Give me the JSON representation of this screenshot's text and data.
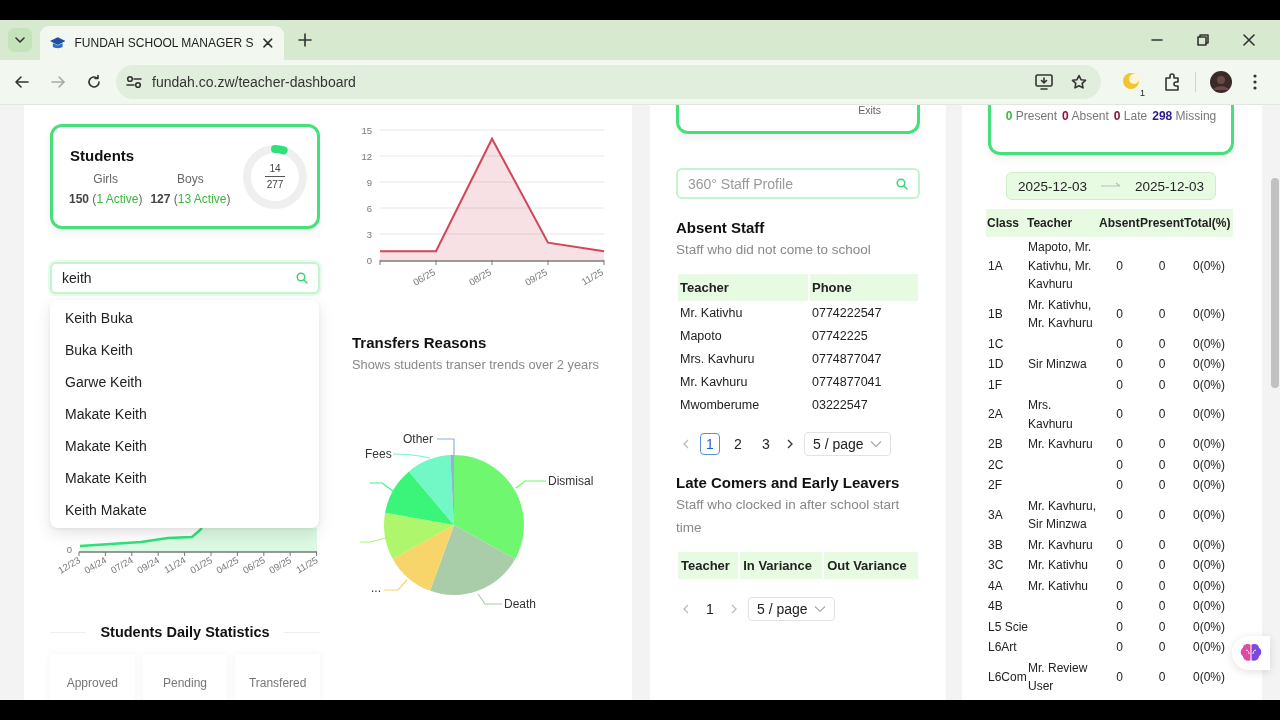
{
  "browser": {
    "tab_title": "FUNDAH SCHOOL MANAGER S",
    "url": "fundah.co.zw/teacher-dashboard",
    "extension_badge": "1"
  },
  "students_card": {
    "title": "Students",
    "groups": [
      {
        "label": "Girls",
        "value": "**150** (*1 Active*)"
      },
      {
        "label": "Boys",
        "value": "**127** (*13 Active*)"
      }
    ],
    "ring": {
      "active": "14",
      "total": "277",
      "level": 0.05
    }
  },
  "student_search": {
    "value": "keith",
    "suggestions": [
      "Keith Buka",
      "Buka Keith",
      "Garwe Keith",
      "Makate Keith",
      "Makate Keith",
      "Makate Keith",
      "Keith Makate"
    ]
  },
  "growth_chart": {
    "kind": "picture",
    "y_tick": "0",
    "x_labels": [
      "12/23",
      "04/24",
      "07/24",
      "09/24",
      "11/24",
      "01/25",
      "04/25",
      "06/25",
      "09/25",
      "11/25"
    ]
  },
  "daily_statistics": {
    "title": "Students Daily Statistics",
    "stats": [
      "Approved",
      "Pending",
      "Transfered"
    ]
  },
  "transfers_trend": {
    "chart_data": {
      "type": "area",
      "categories": [
        null,
        "06/25",
        "08/25",
        "09/25",
        "11/25"
      ],
      "ylim": [
        0,
        15
      ],
      "yticks": [
        0,
        3,
        6,
        9,
        12,
        15
      ],
      "grid": true,
      "series": [
        {
          "color": "#d0465a",
          "values": [
            1,
            1,
            14,
            2,
            1
          ]
        }
      ]
    }
  },
  "transfer_reasons": {
    "title": "Transfers Reasons",
    "subtitle": "Shows students transer trends over 2 years",
    "slices": [
      {
        "label": "Dismisal",
        "color": "#6ff76f"
      },
      {
        "label": "Death",
        "color": "#a8cda8"
      },
      {
        "label": "...",
        "color": "#f7d56b"
      },
      {
        "color": "#aef76d"
      },
      {
        "color": "#3bf57a"
      },
      {
        "label": "Fees",
        "color": "#72f7c6"
      },
      {
        "label": "Other",
        "color": "#8fb4d4"
      }
    ]
  },
  "staff_summary_card": {
    "text": "Exits"
  },
  "staff_search": {
    "placeholder": "360° Staff Profile"
  },
  "absent_staff": {
    "title": "Absent Staff",
    "subtitle": "Staff who did not come to school",
    "columns": [
      "Teacher",
      "Phone"
    ],
    "rows": [
      [
        "Mr. Kativhu",
        "0774222547"
      ],
      [
        "Mapoto",
        "07742225"
      ],
      [
        "Mrs. Kavhuru",
        "0774877047"
      ],
      [
        "Mr. Kavhuru",
        "0774877041"
      ],
      [
        "Mwomberume",
        "03222547"
      ]
    ],
    "pagination": {
      "prev_disabled": true,
      "next_disabled": false,
      "pages": [
        {
          "label": "1",
          "selected": true
        },
        {
          "label": "2",
          "selected": false
        },
        {
          "label": "3",
          "selected": false
        }
      ],
      "page_size": "5 / page"
    }
  },
  "late_comers": {
    "title": "Late Comers and Early Leavers",
    "subtitle": "Staff who clocked in after school start time",
    "columns": [
      "Teacher",
      "In Variance",
      "Out Variance"
    ],
    "pagination": {
      "prev_disabled": true,
      "next_disabled": true,
      "pages": [
        {
          "label": "1",
          "selected": false
        }
      ],
      "page_size": "5 / page"
    }
  },
  "attendance_summary": {
    "counts": [
      {
        "text": "**0** Present",
        "color": "#3db83d"
      },
      {
        "text": "**0** Absent",
        "color": "#8c1131"
      },
      {
        "text": "**0** Late",
        "color": "#8c1131"
      },
      {
        "text": "**298** Missing",
        "color": "#2c1a8e"
      }
    ]
  },
  "date_range": {
    "start": "2025-12-03",
    "end": "2025-12-03"
  },
  "class_attendance": {
    "columns": [
      "Class",
      "Teacher",
      "Absent",
      "Present",
      "Total(%)"
    ],
    "rows": [
      {
        "class": "1A",
        "teacher": "Mapoto, Mr. Kativhu, Mr. Kavhuru",
        "absent": "0",
        "present": "0",
        "total": "0(0%)"
      },
      {
        "class": "1B",
        "teacher": "Mr. Kativhu, Mr. Kavhuru",
        "absent": "0",
        "present": "0",
        "total": "0(0%)"
      },
      {
        "class": "1C",
        "absent": "0",
        "present": "0",
        "total": "0(0%)"
      },
      {
        "class": "1D",
        "teacher": "Sir Minzwa",
        "absent": "0",
        "present": "0",
        "total": "0(0%)"
      },
      {
        "class": "1F",
        "absent": "0",
        "present": "0",
        "total": "0(0%)"
      },
      {
        "class": "2A",
        "teacher": "Mrs. Kavhuru",
        "absent": "0",
        "present": "0",
        "total": "0(0%)"
      },
      {
        "class": "2B",
        "teacher": "Mr. Kavhuru",
        "absent": "0",
        "present": "0",
        "total": "0(0%)"
      },
      {
        "class": "2C",
        "absent": "0",
        "present": "0",
        "total": "0(0%)"
      },
      {
        "class": "2F",
        "absent": "0",
        "present": "0",
        "total": "0(0%)"
      },
      {
        "class": "3A",
        "teacher": "Mr. Kavhuru, Sir Minzwa",
        "absent": "0",
        "present": "0",
        "total": "0(0%)"
      },
      {
        "class": "3B",
        "teacher": "Mr. Kavhuru",
        "absent": "0",
        "present": "0",
        "total": "0(0%)"
      },
      {
        "class": "3C",
        "teacher": "Mr. Kativhu",
        "absent": "0",
        "present": "0",
        "total": "0(0%)"
      },
      {
        "class": "4A",
        "teacher": "Mr. Kativhu",
        "absent": "0",
        "present": "0",
        "total": "0(0%)"
      },
      {
        "class": "4B",
        "absent": "0",
        "present": "0",
        "total": "0(0%)"
      },
      {
        "class": "L5 Scie",
        "absent": "0",
        "present": "0",
        "total": "0(0%)"
      },
      {
        "class": "L6Art",
        "absent": "0",
        "present": "0",
        "total": "0(0%)"
      },
      {
        "class": "L6Com",
        "teacher": "Mr. Review User",
        "absent": "0",
        "present": "0",
        "total": "0(0%)"
      }
    ]
  }
}
